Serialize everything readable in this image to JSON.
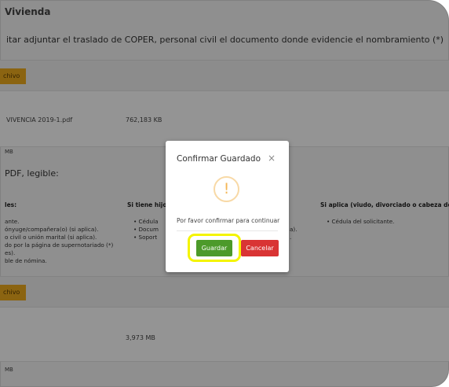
{
  "section": {
    "title": "Vivienda",
    "instruction": "itar adjuntar el traslado de COPER, personal civil el documento donde evidencie el nombramiento (*)"
  },
  "upload1": {
    "button_label": "chivo",
    "file_name": "VIVENCIA 2019-1.pdf",
    "file_size": "762,183 KB",
    "max_size": "MB"
  },
  "format_note": "PDF, legible:",
  "requirements": {
    "col1_title": "les:",
    "col1_items": [
      "ante.",
      "ónyuge/compañera(o) (si aplica).",
      "o civil o unión marital (si aplica).",
      "do por la página de supernotariado (*)",
      "es).",
      "ble de nómina."
    ],
    "col2_title": "Si tiene hijo",
    "col2_items": [
      "• Cédula",
      "• Docum",
      "• Soport"
    ],
    "col2_suffixes": [
      "a).",
      "."
    ],
    "col3_title": "Si aplica (viudo, divorciado o cabeza de f",
    "col3_items": [
      "• Cédula del solicitante."
    ]
  },
  "upload2": {
    "button_label": "chivo",
    "file_size": "3,973 MB",
    "max_size": "MB"
  },
  "modal": {
    "title": "Confirmar Guardado",
    "close_glyph": "×",
    "icon_glyph": "!",
    "message": "Por favor confirmar para continuar",
    "confirm_label": "Guardar",
    "cancel_label": "Cancelar"
  },
  "colors": {
    "confirm": "#4c9a2a",
    "cancel": "#d93434",
    "upload_button": "#f0ad1e",
    "highlight": "#f4f400",
    "warning_icon": "#f4b655"
  }
}
